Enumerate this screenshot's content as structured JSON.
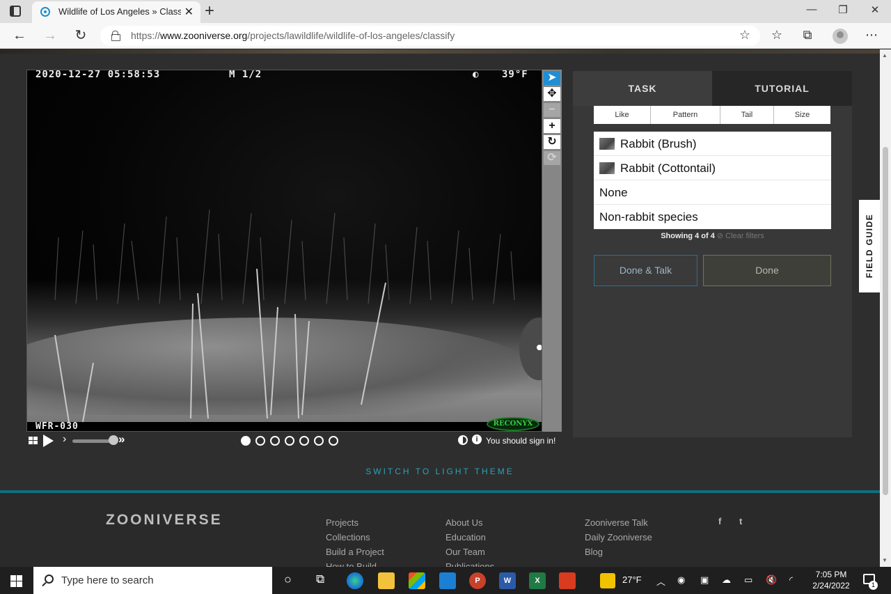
{
  "browser": {
    "tab_title": "Wildlife of Los Angeles » Classify",
    "url_prefix": "https://",
    "url_host": "www.zooniverse.org",
    "url_path": "/projects/lawildlife/wildlife-of-los-angeles/classify"
  },
  "subject": {
    "timestamp": "2020-12-27  05:58:53",
    "frame_label": "M 1/2",
    "moon_icon": "moon-phase-icon",
    "temperature": "39°F",
    "camera_id": "WFR-030",
    "camera_brand": "RECONYX",
    "frame_count": 7,
    "current_frame": 1,
    "sign_in_notice": "You should sign in!",
    "info_glyph": "i"
  },
  "tools": [
    "pointer-icon",
    "move-icon",
    "zoom-out-icon",
    "zoom-in-icon",
    "rotate-icon",
    "reset-icon"
  ],
  "task_panel": {
    "tabs": [
      "TASK",
      "TUTORIAL"
    ],
    "filters": [
      "Like",
      "Pattern",
      "Tail",
      "Size"
    ],
    "choices": [
      {
        "label": "Rabbit (Brush)",
        "has_thumb": true
      },
      {
        "label": "Rabbit (Cottontail)",
        "has_thumb": true
      },
      {
        "label": "None",
        "has_thumb": false
      },
      {
        "label": "Non-rabbit species",
        "has_thumb": false
      }
    ],
    "showing": "Showing 4 of 4",
    "clear_filters": "Clear filters",
    "done_talk": "Done & Talk",
    "done": "Done"
  },
  "field_guide": "FIELD GUIDE",
  "switch_theme": "SWITCH TO LIGHT THEME",
  "footer": {
    "logo": "ZOONIVERSE",
    "col1": [
      "Projects",
      "Collections",
      "Build a Project",
      "How to Build"
    ],
    "col2": [
      "About Us",
      "Education",
      "Our Team",
      "Publications"
    ],
    "col3": [
      "Zooniverse Talk",
      "Daily Zooniverse",
      "Blog"
    ],
    "social": [
      "f",
      "t"
    ]
  },
  "taskbar": {
    "search_placeholder": "Type here to search",
    "weather": "27°F",
    "time": "7:05 PM",
    "date": "2/24/2022",
    "notifications": "1",
    "apps": [
      "P",
      "W",
      "X"
    ]
  }
}
